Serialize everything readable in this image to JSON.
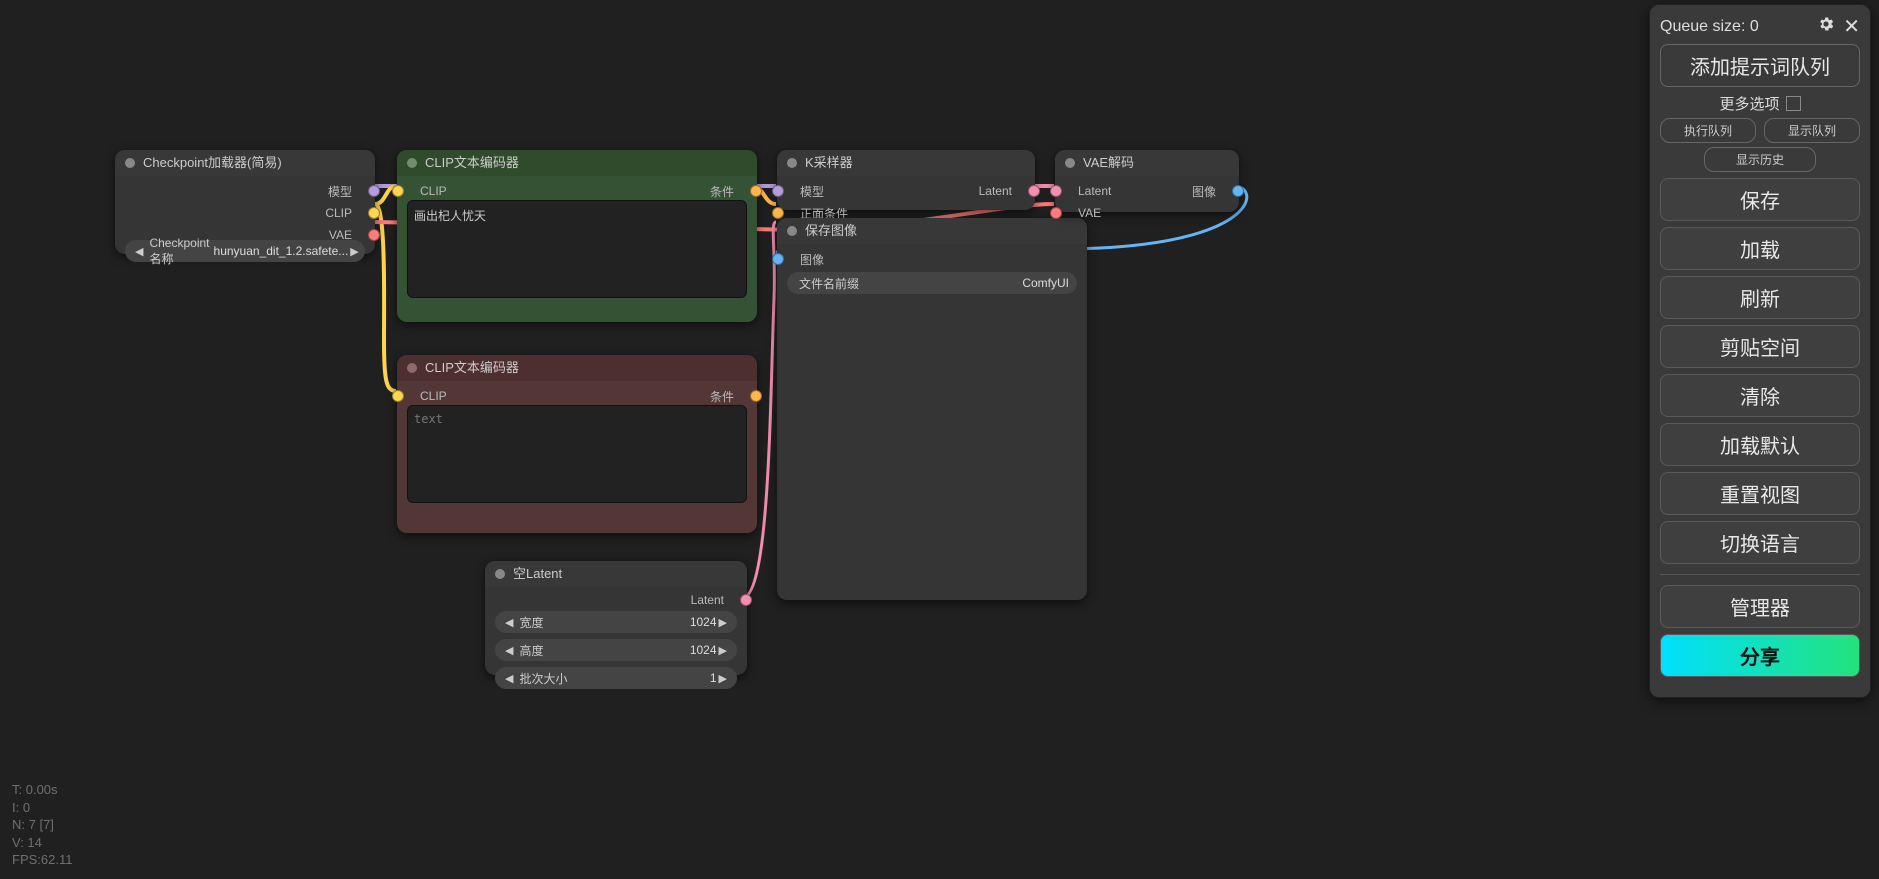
{
  "panel": {
    "queue_label": "Queue size: 0",
    "queue_prompt": "添加提示词队列",
    "more_options": "更多选项",
    "exec_queue": "执行队列",
    "show_queue": "显示队列",
    "show_history": "显示历史",
    "save": "保存",
    "load": "加载",
    "refresh": "刷新",
    "clipspace": "剪贴空间",
    "clear": "清除",
    "load_default": "加载默认",
    "reset_view": "重置视图",
    "toggle_lang": "切换语言",
    "manager": "管理器",
    "share": "分享"
  },
  "stats": {
    "t": "T: 0.00s",
    "i": "I: 0",
    "n": "N: 7 [7]",
    "v": "V: 14",
    "fps": "FPS:62.11"
  },
  "nodes": {
    "checkpoint": {
      "title": "Checkpoint加载器(简易)",
      "outputs": {
        "model": "模型",
        "clip": "CLIP",
        "vae": "VAE"
      },
      "widget_label": "Checkpoint名称",
      "widget_value": "hunyuan_dit_1.2.safete..."
    },
    "clip_pos": {
      "title": "CLIP文本编码器",
      "in_clip": "CLIP",
      "out_cond": "条件",
      "text": "画出杞人忧天"
    },
    "clip_neg": {
      "title": "CLIP文本编码器",
      "in_clip": "CLIP",
      "out_cond": "条件",
      "placeholder": "text"
    },
    "empty_latent": {
      "title": "空Latent",
      "out_latent": "Latent",
      "width_label": "宽度",
      "width_value": "1024",
      "height_label": "高度",
      "height_value": "1024",
      "batch_label": "批次大小",
      "batch_value": "1"
    },
    "ksampler": {
      "title": "K采样器",
      "in_model": "模型",
      "in_pos": "正面条件",
      "out_latent": "Latent"
    },
    "vae_decode": {
      "title": "VAE解码",
      "in_latent": "Latent",
      "in_vae": "VAE",
      "out_image": "图像"
    },
    "save_image": {
      "title": "保存图像",
      "in_image": "图像",
      "prefix_label": "文件名前缀",
      "prefix_value": "ComfyUI"
    }
  },
  "colors": {
    "model": "#b39ddb",
    "clip": "#ffd54f",
    "vae": "#ff7a7a",
    "cond": "#ffb74d",
    "latent": "#f48fb1",
    "image": "#64b5f6"
  }
}
